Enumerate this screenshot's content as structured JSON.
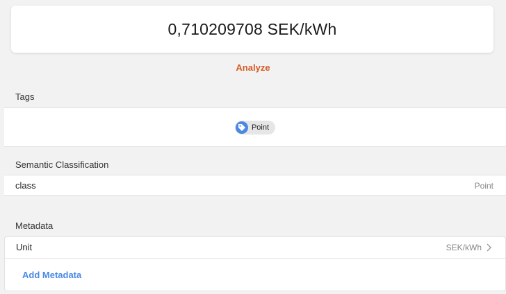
{
  "value_display": {
    "text": "0,710209708 SEK/kWh"
  },
  "analyze": {
    "label": "Analyze"
  },
  "tags": {
    "title": "Tags",
    "items": [
      {
        "label": "Point",
        "icon": "tag-icon"
      }
    ]
  },
  "semantic": {
    "title": "Semantic Classification",
    "rows": [
      {
        "key": "class",
        "value": "Point"
      }
    ]
  },
  "metadata": {
    "title": "Metadata",
    "rows": [
      {
        "key": "Unit",
        "value": "SEK/kWh",
        "icon": "chevron-right-icon"
      }
    ],
    "add_label": "Add Metadata"
  },
  "colors": {
    "accent_orange": "#d65a22",
    "accent_blue": "#4a89e3",
    "background": "#f2f2f2"
  }
}
